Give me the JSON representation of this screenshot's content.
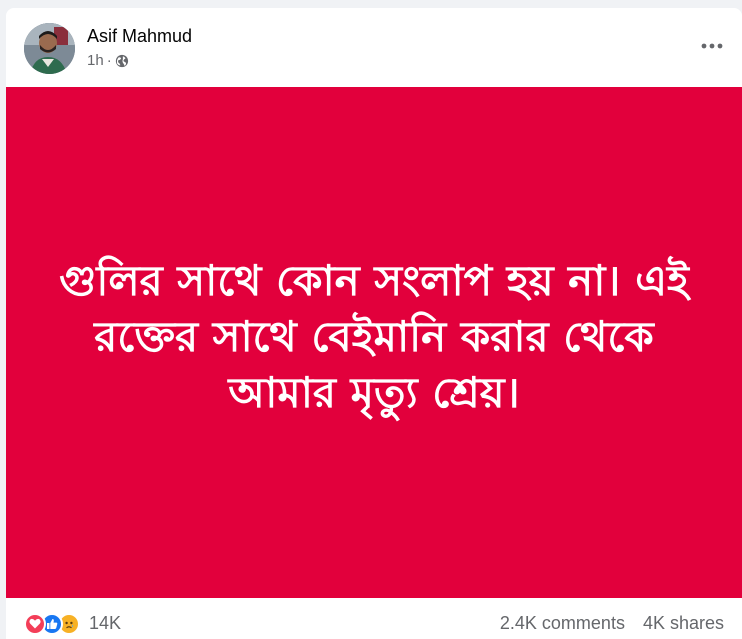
{
  "post": {
    "author": "Asif Mahmud",
    "time": "1h",
    "separator": "·",
    "privacy_icon": "globe-icon",
    "more_icon": "more-dots-icon",
    "text_lines": [
      "গুলির সাথে কোন সংলাপ হয় না। এই",
      "রক্তের সাথে বেইমানি করার থেকে",
      "আমার মৃত্যু শ্রেয়।"
    ],
    "background_color": "#e2003c",
    "text_color": "#ffffff"
  },
  "footer": {
    "reaction_icons": [
      "love-icon",
      "like-icon",
      "sad-icon"
    ],
    "reaction_count": "14K",
    "comments": "2.4K comments",
    "shares": "4K shares"
  },
  "colors": {
    "like_blue": "#1877f2",
    "love_red": "#f33e58",
    "sad_yellow": "#f7b125",
    "meta_gray": "#65676b"
  }
}
